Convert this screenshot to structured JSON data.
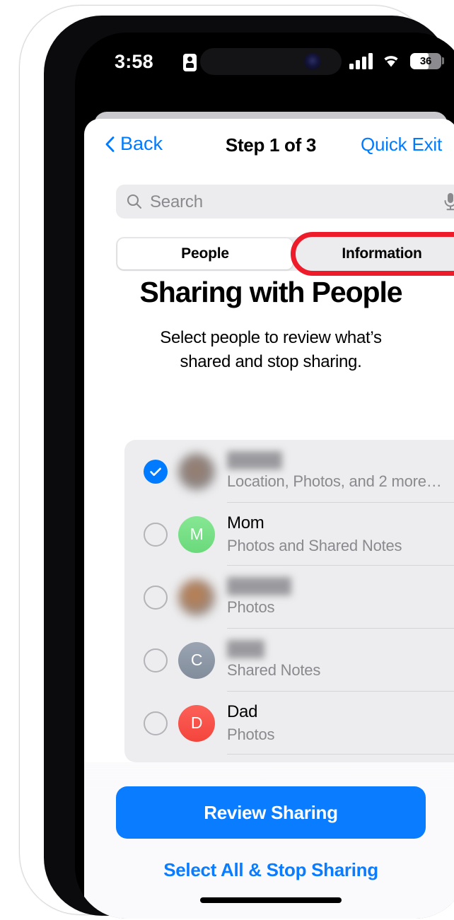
{
  "status_bar": {
    "time": "3:58",
    "recording_icon": "id-card-icon",
    "battery_level": "36",
    "signal_icon": "cellular-signal-icon",
    "wifi_icon": "wifi-icon"
  },
  "nav": {
    "back_label": "Back",
    "title": "Step 1 of 3",
    "quick_exit_label": "Quick Exit"
  },
  "search": {
    "placeholder": "Search",
    "search_icon": "search-icon",
    "mic_icon": "microphone-icon"
  },
  "segmented_control": {
    "options": [
      {
        "label": "People",
        "selected": true
      },
      {
        "label": "Information",
        "selected": false
      }
    ],
    "highlight_color": "#ee1c2b",
    "highlighted_option": "Information"
  },
  "header": {
    "title": "Sharing with People",
    "subtitle": "Select people to review what’s shared and stop sharing."
  },
  "people": [
    {
      "name": "",
      "name_redacted": true,
      "detail": "Location, Photos, and 2 more…",
      "selected": true,
      "avatar_type": "photo",
      "avatar_initial": "",
      "avatar_color": "#8d8d91"
    },
    {
      "name": "Mom",
      "name_redacted": false,
      "detail": "Photos and Shared Notes",
      "selected": false,
      "avatar_type": "initial",
      "avatar_initial": "M",
      "avatar_color": "#76de84"
    },
    {
      "name": "",
      "name_redacted": true,
      "detail": "Photos",
      "selected": false,
      "avatar_type": "photo",
      "avatar_initial": "",
      "avatar_color": "#9c7d6e"
    },
    {
      "name": "",
      "name_redacted": true,
      "detail": "Shared Notes",
      "selected": false,
      "avatar_type": "initial",
      "avatar_initial": "C",
      "avatar_color": "#8e99a8"
    },
    {
      "name": "Dad",
      "name_redacted": false,
      "detail": "Photos",
      "selected": false,
      "avatar_type": "initial",
      "avatar_initial": "D",
      "avatar_color": "#f6504a"
    }
  ],
  "footer": {
    "primary_button_label": "Review Sharing",
    "secondary_link_label": "Select All & Stop Sharing",
    "accent_color": "#0a7cff"
  }
}
